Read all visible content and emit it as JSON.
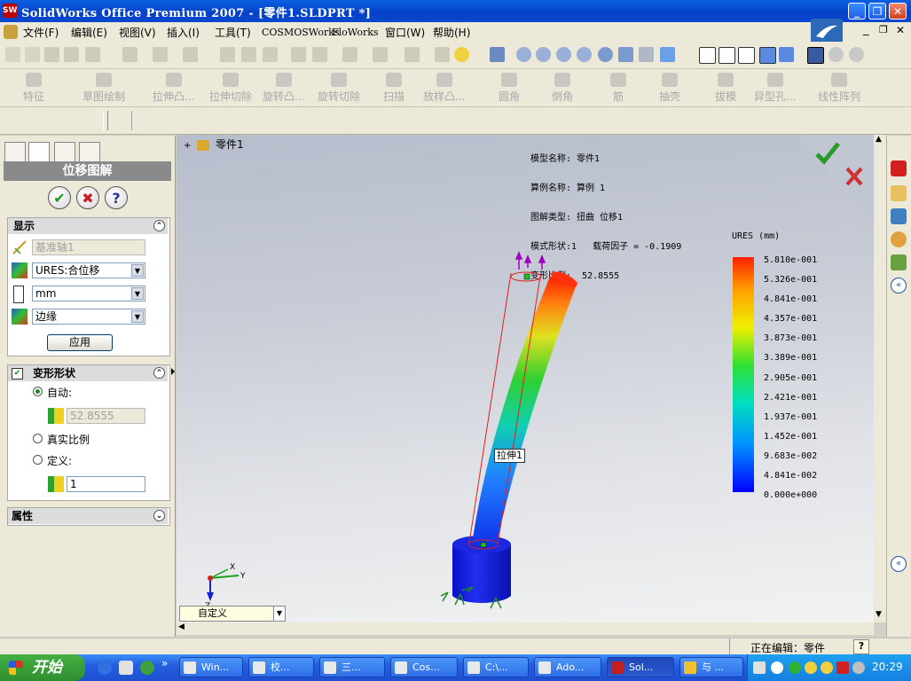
{
  "window": {
    "title": "SolidWorks Office Premium 2007 - [零件1.SLDPRT *]",
    "app_icon": "SW"
  },
  "menu": [
    {
      "label": "文件(F)"
    },
    {
      "label": "编辑(E)"
    },
    {
      "label": "视图(V)"
    },
    {
      "label": "插入(I)"
    },
    {
      "label": "工具(T)"
    },
    {
      "label": "COSMOSWorks"
    },
    {
      "label": "FloWorks"
    },
    {
      "label": "窗口(W)"
    },
    {
      "label": "帮助(H)"
    }
  ],
  "features_toolbar": [
    {
      "label": "特征"
    },
    {
      "label": "草图绘制"
    },
    {
      "label": "拉伸凸..."
    },
    {
      "label": "拉伸切除"
    },
    {
      "label": "旋转凸..."
    },
    {
      "label": "旋转切除"
    },
    {
      "label": "扫描"
    },
    {
      "label": "放样凸..."
    },
    {
      "label": "圆角"
    },
    {
      "label": "倒角"
    },
    {
      "label": "筋"
    },
    {
      "label": "抽壳"
    },
    {
      "label": "拔模"
    },
    {
      "label": "异型孔..."
    },
    {
      "label": "线性阵列"
    }
  ],
  "property_manager": {
    "title": "位移图解",
    "ok_symbol": "✔",
    "cancel_symbol": "✖",
    "help_symbol": "?",
    "display_group": {
      "title": "显示",
      "axis_field": "基准轴1",
      "component_select": "URES:合位移",
      "unit_select": "mm",
      "edge_select": "边缘",
      "apply_button": "应用"
    },
    "deform_group": {
      "title": "变形形状",
      "checked": true,
      "auto_label": "自动:",
      "auto_value": "52.8555",
      "true_scale_label": "真实比例",
      "defined_label": "定义:",
      "defined_value": "1",
      "selected": "auto"
    },
    "properties_group": {
      "title": "属性"
    }
  },
  "viewport": {
    "tree_root": "零件1",
    "info": {
      "line1": "模型名称: 零件1",
      "line2": "算例名称: 算例 1",
      "line3": "图解类型: 扭曲 位移1",
      "line4": "模式形状:1   载荷因子 = -0.1909",
      "line5": "变形比例:  52.8555"
    },
    "feature_tag": "拉伸1",
    "view_dropdown": "自定义",
    "triad_axes": [
      "X",
      "Y",
      "Z"
    ]
  },
  "legend": {
    "title": "URES (mm)",
    "labels": [
      "5.810e-001",
      "5.326e-001",
      "4.841e-001",
      "4.357e-001",
      "3.873e-001",
      "3.389e-001",
      "2.905e-001",
      "2.421e-001",
      "1.937e-001",
      "1.452e-001",
      "9.683e-002",
      "4.841e-002",
      "0.000e+000"
    ],
    "gradient_top": "#ff2000",
    "gradient_bottom": "#0000ff"
  },
  "status": {
    "editing": "正在编辑：零件",
    "help": "?"
  },
  "taskbar": {
    "start": "开始",
    "tasks": [
      {
        "label": "Win..."
      },
      {
        "label": "校..."
      },
      {
        "label": "三..."
      },
      {
        "label": "Cos..."
      },
      {
        "label": "C:\\..."
      },
      {
        "label": "Ado..."
      },
      {
        "label": "Sol...",
        "active": true
      },
      {
        "label": "与 ..."
      }
    ],
    "clock": "20:29"
  }
}
